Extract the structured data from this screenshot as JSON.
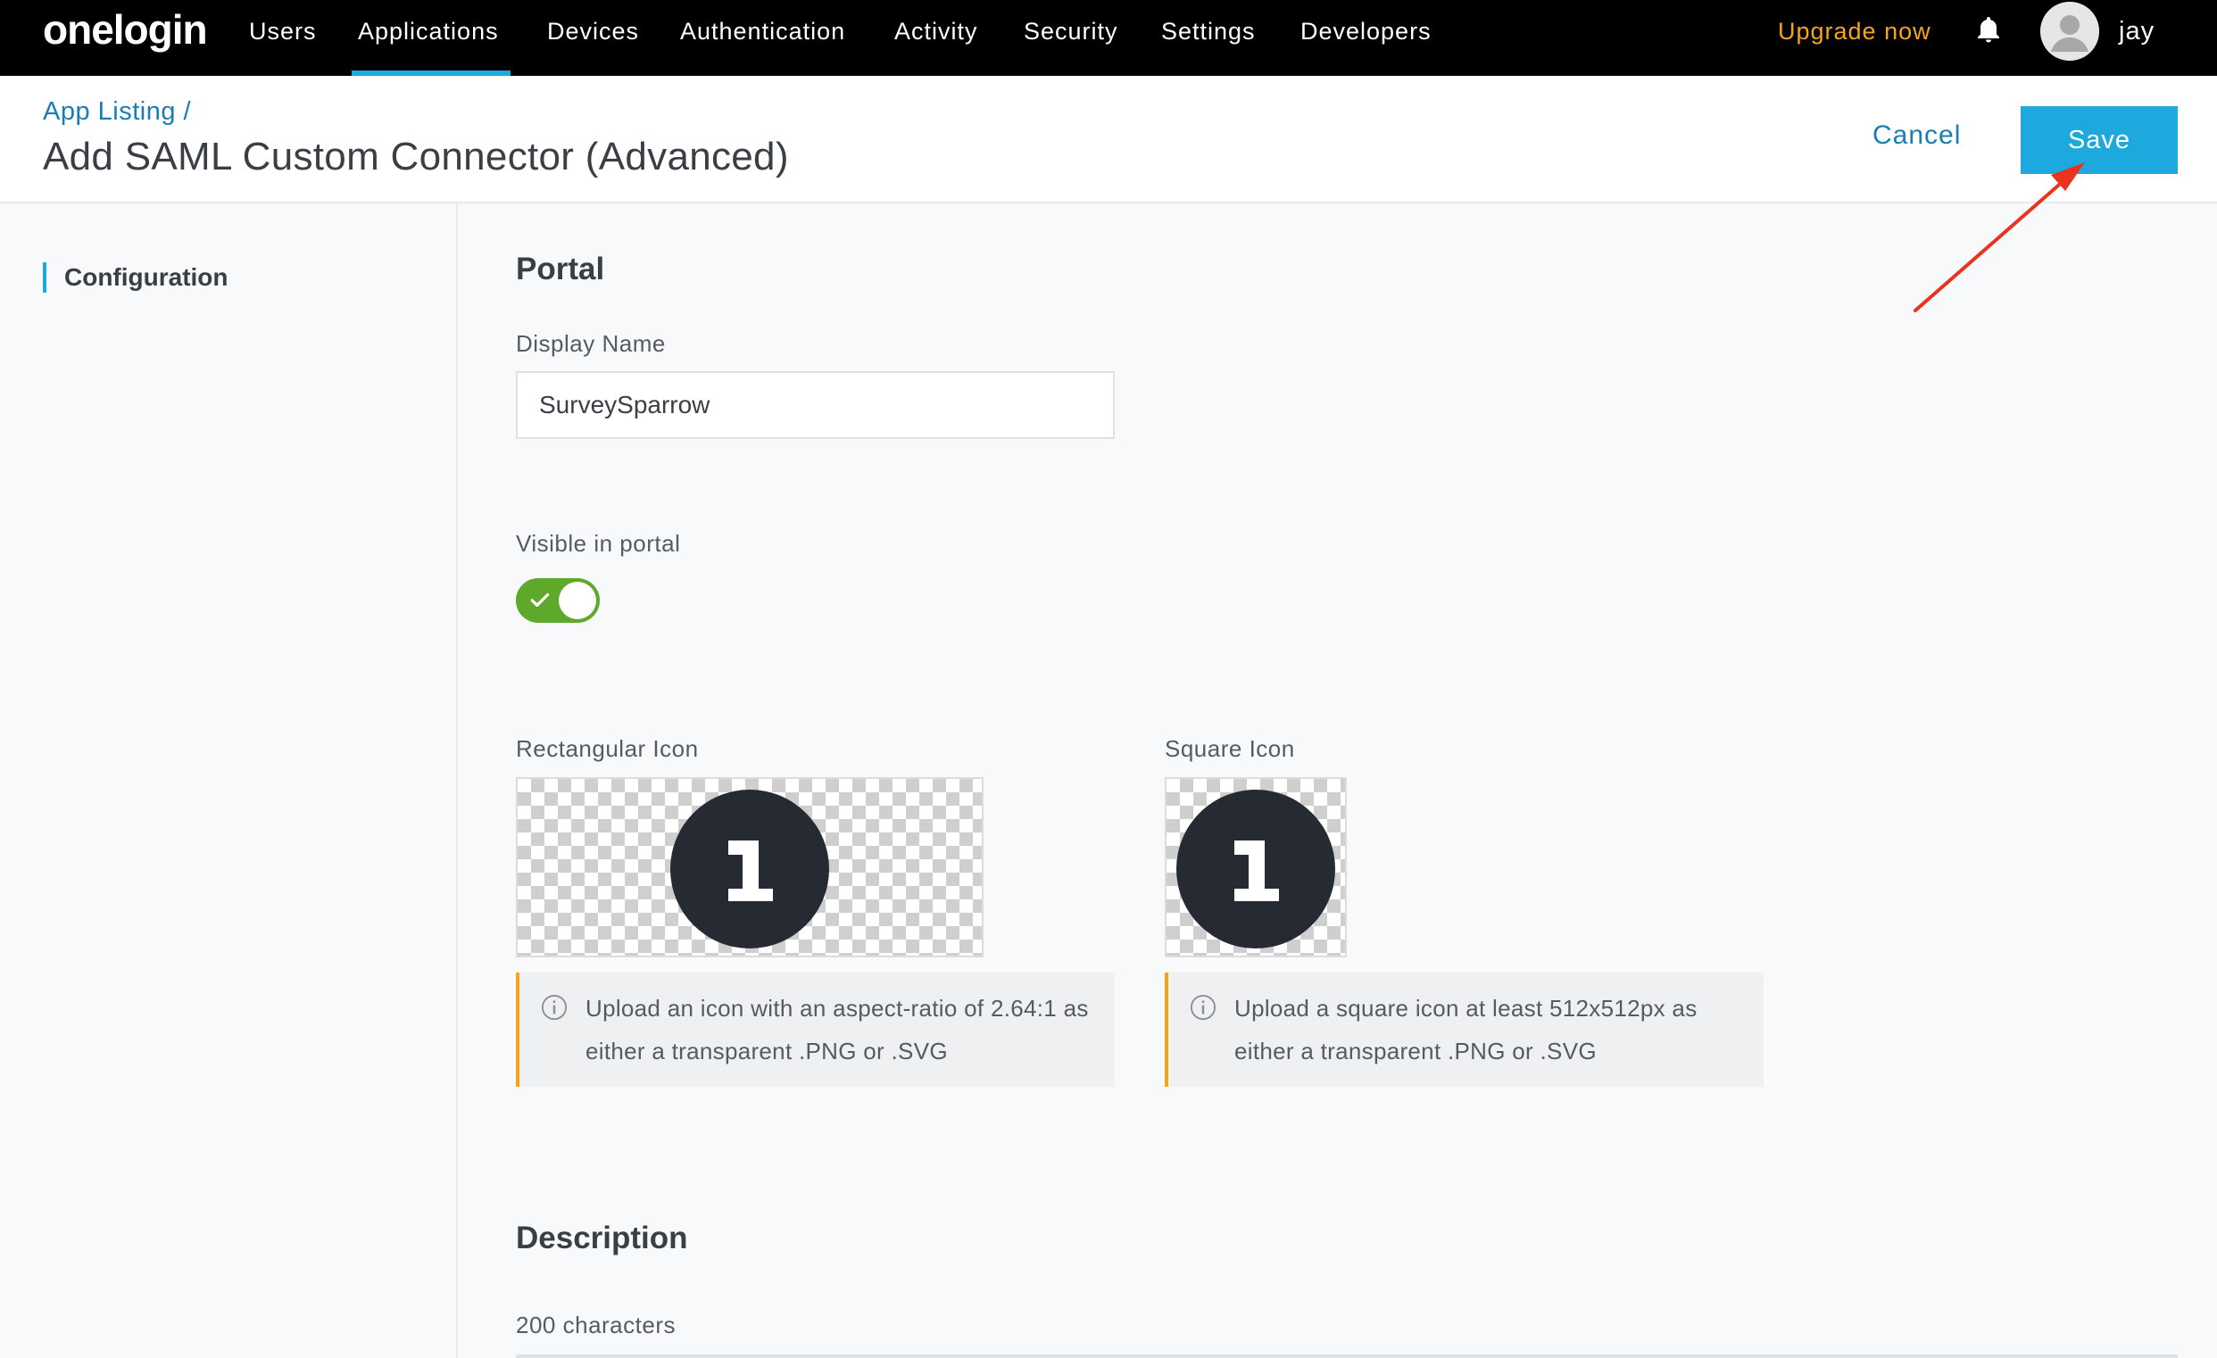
{
  "nav": {
    "logo": "onelogin",
    "items": [
      {
        "label": "Users"
      },
      {
        "label": "Applications"
      },
      {
        "label": "Devices"
      },
      {
        "label": "Authentication"
      },
      {
        "label": "Activity"
      },
      {
        "label": "Security"
      },
      {
        "label": "Settings"
      },
      {
        "label": "Developers"
      }
    ],
    "active_item": "Applications",
    "upgrade_label": "Upgrade now",
    "user_name": "jay",
    "bell_icon": "bell-icon",
    "avatar_icon": "user-avatar-icon"
  },
  "header": {
    "breadcrumb": "App Listing /",
    "title": "Add SAML Custom Connector (Advanced)",
    "cancel_label": "Cancel",
    "save_label": "Save"
  },
  "sidebar": {
    "items": [
      {
        "label": "Configuration",
        "active": true
      }
    ]
  },
  "portal": {
    "section_title": "Portal",
    "display_name_label": "Display Name",
    "display_name_value": "SurveySparrow",
    "visible_label": "Visible in portal",
    "visible_on": true,
    "rect_icon_label": "Rectangular Icon",
    "square_icon_label": "Square Icon",
    "rect_icon_hint": "Upload an icon with an aspect-ratio of 2.64:1 as either a transparent .PNG or .SVG",
    "square_icon_hint": "Upload a square icon at least 512x512px as either a transparent .PNG or .SVG"
  },
  "description": {
    "section_title": "Description",
    "chars_label": "200 characters"
  },
  "colors": {
    "accent": "#1da9de",
    "link": "#1a7db3",
    "upgrade": "#f7a41d",
    "toggle_on": "#5ea82a",
    "info_border": "#f7a41d",
    "annotation_arrow": "#e8331f"
  }
}
